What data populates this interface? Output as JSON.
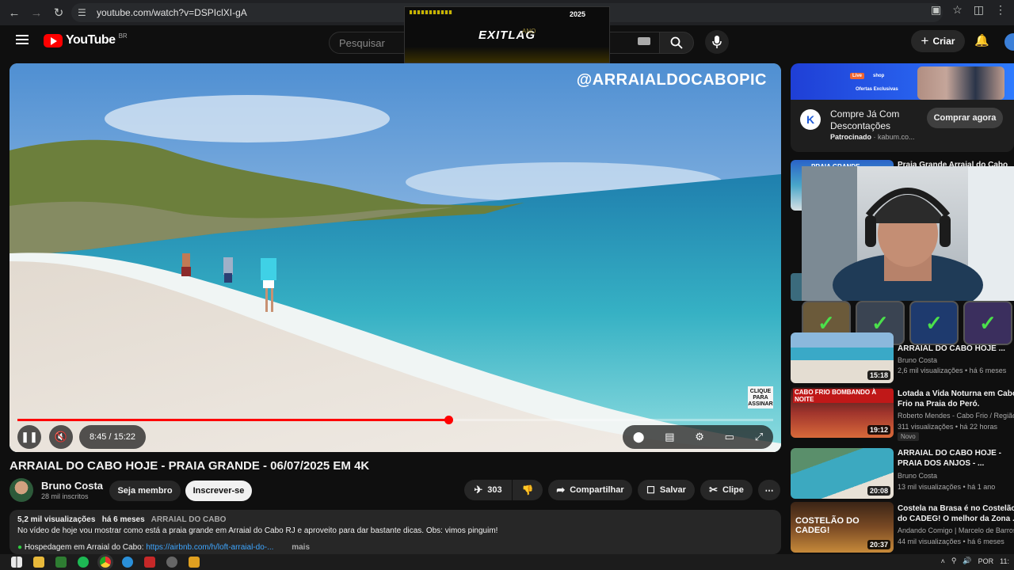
{
  "browser": {
    "url": "youtube.com/watch?v=DSPIclXI-gA"
  },
  "exitlag": {
    "logo": "EXITLAG",
    "badge": "2025",
    "ano": "ANO"
  },
  "header": {
    "logo_text": "YouTube",
    "country": "BR",
    "search_placeholder": "Pesquisar",
    "create_label": "Criar"
  },
  "video": {
    "watermark": "@ARRAIALDOCABOPIC",
    "subscribe_tag": "CLIQUE PARA ASSINAR",
    "time": "8:45 / 15:22",
    "progress": 0.57
  },
  "info": {
    "title": "ARRAIAL DO CABO HOJE - PRAIA GRANDE - 06/07/2025 EM 4K",
    "channel": "Bruno Costa",
    "subs": "28 mil inscritos",
    "member_label": "Seja membro",
    "subscribe_label": "Inscrever-se",
    "likes": "303",
    "share_label": "Compartilhar",
    "save_label": "Salvar",
    "clip_label": "Clipe"
  },
  "description": {
    "views": "5,2 mil visualizações",
    "age": "há 6 meses",
    "category": "ARRAIAL DO CABO",
    "text": "No vídeo de hoje vou mostrar como está a praia grande em Arraial do Cabo RJ e aproveito para dar bastante dicas. Obs: vimos pinguim!",
    "lodging_label": "Hospedagem em Arraial do Cabo:",
    "lodging_link": "https://airbnb.com/h/loft-arraial-do-...",
    "more": "mais"
  },
  "ad": {
    "title": "Compre Já Com Descontações",
    "sponsored": "Patrocinado",
    "domain": "kabum.co...",
    "button": "Comprar agora",
    "banner_live": "Live",
    "banner_shop": "shop",
    "banner_offers": "Ofertas Exclusivas"
  },
  "recommendations": [
    {
      "title": "Praia Grande Arraial do Cabo",
      "thumb_label": "PRAIA GRANDE"
    },
    {
      "title": "ARRAIAL DO CABO HOJE ...",
      "channel": "Bruno Costa",
      "meta": "2,6 mil visualizações • há 6 meses",
      "duration": "15:18"
    },
    {
      "title": "Lotada a Vida Noturna em Cabo Frio na Praia do Peró.",
      "title2": "Frio na Praia do Peró.",
      "channel": "Roberto Mendes - Cabo Frio / Região",
      "meta": "311 visualizações • há 22 horas",
      "badge": "Novo",
      "duration": "19:12",
      "thumb_label": "CABO FRIO BOMBANDO À NOITE"
    },
    {
      "title": "ARRAIAL DO CABO HOJE -",
      "title2": "PRAIA DOS ANJOS - ...",
      "channel": "Bruno Costa",
      "meta": "13 mil visualizações • há 1 ano",
      "duration": "20:08"
    },
    {
      "title": "Costela na Brasa é no Costelão",
      "title2": "do CADEG! O melhor da Zona ...",
      "channel": "Andando Comigo | Marcelo de Barros",
      "meta": "44 mil visualizações • há 6 meses",
      "duration": "20:37",
      "thumb_label": "COSTELÃO DO CADEG!"
    }
  ],
  "taskbar": {
    "lang": "POR",
    "clock": "11:"
  }
}
